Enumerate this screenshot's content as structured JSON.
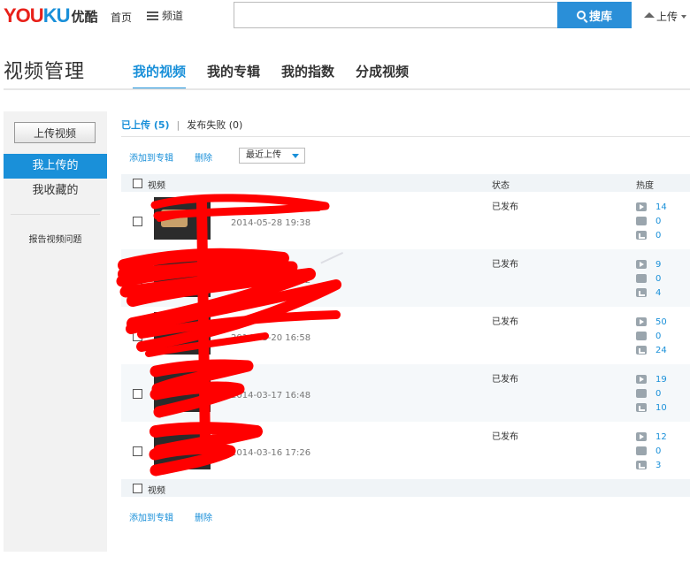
{
  "topbar": {
    "logo_text": "YOUKU",
    "logo_cn": "优酷",
    "home": "首页",
    "channel": "频道",
    "search_placeholder": "",
    "search_button": "搜库",
    "upload": "上传"
  },
  "header": {
    "title": "视频管理",
    "tabs": [
      "我的视频",
      "我的专辑",
      "我的指数",
      "分成视频"
    ],
    "active_tab": 0
  },
  "sidebar": {
    "upload_button": "上传视频",
    "items": [
      "我上传的",
      "我收藏的"
    ],
    "report": "报告视频问题"
  },
  "main": {
    "status_tabs": {
      "uploaded": "已上传 (5)",
      "separator": "|",
      "failed": "发布失败 (0)"
    },
    "actions": {
      "add_to_album": "添加到专辑",
      "delete": "删除"
    },
    "sort": "最近上传",
    "columns": {
      "video": "视频",
      "status": "状态",
      "heat": "热度"
    },
    "rows": [
      {
        "date": "2014-05-28 19:38",
        "status": "已发布",
        "plays": "14",
        "comments": "0",
        "shares": "0"
      },
      {
        "date": "2014-03-21 19:12",
        "status": "已发布",
        "plays": "9",
        "comments": "0",
        "shares": "4"
      },
      {
        "date": "2014-03-20 16:58",
        "status": "已发布",
        "plays": "50",
        "comments": "0",
        "shares": "24"
      },
      {
        "date": "2014-03-17 16:48",
        "status": "已发布",
        "plays": "19",
        "comments": "0",
        "shares": "10"
      },
      {
        "date": "2014-03-16 17:26",
        "status": "已发布",
        "plays": "12",
        "comments": "0",
        "shares": "3"
      }
    ],
    "footer_video": "视频"
  },
  "colors": {
    "accent": "#1a90d9",
    "scribble": "#ff0000",
    "brand_red": "#e8211a"
  }
}
